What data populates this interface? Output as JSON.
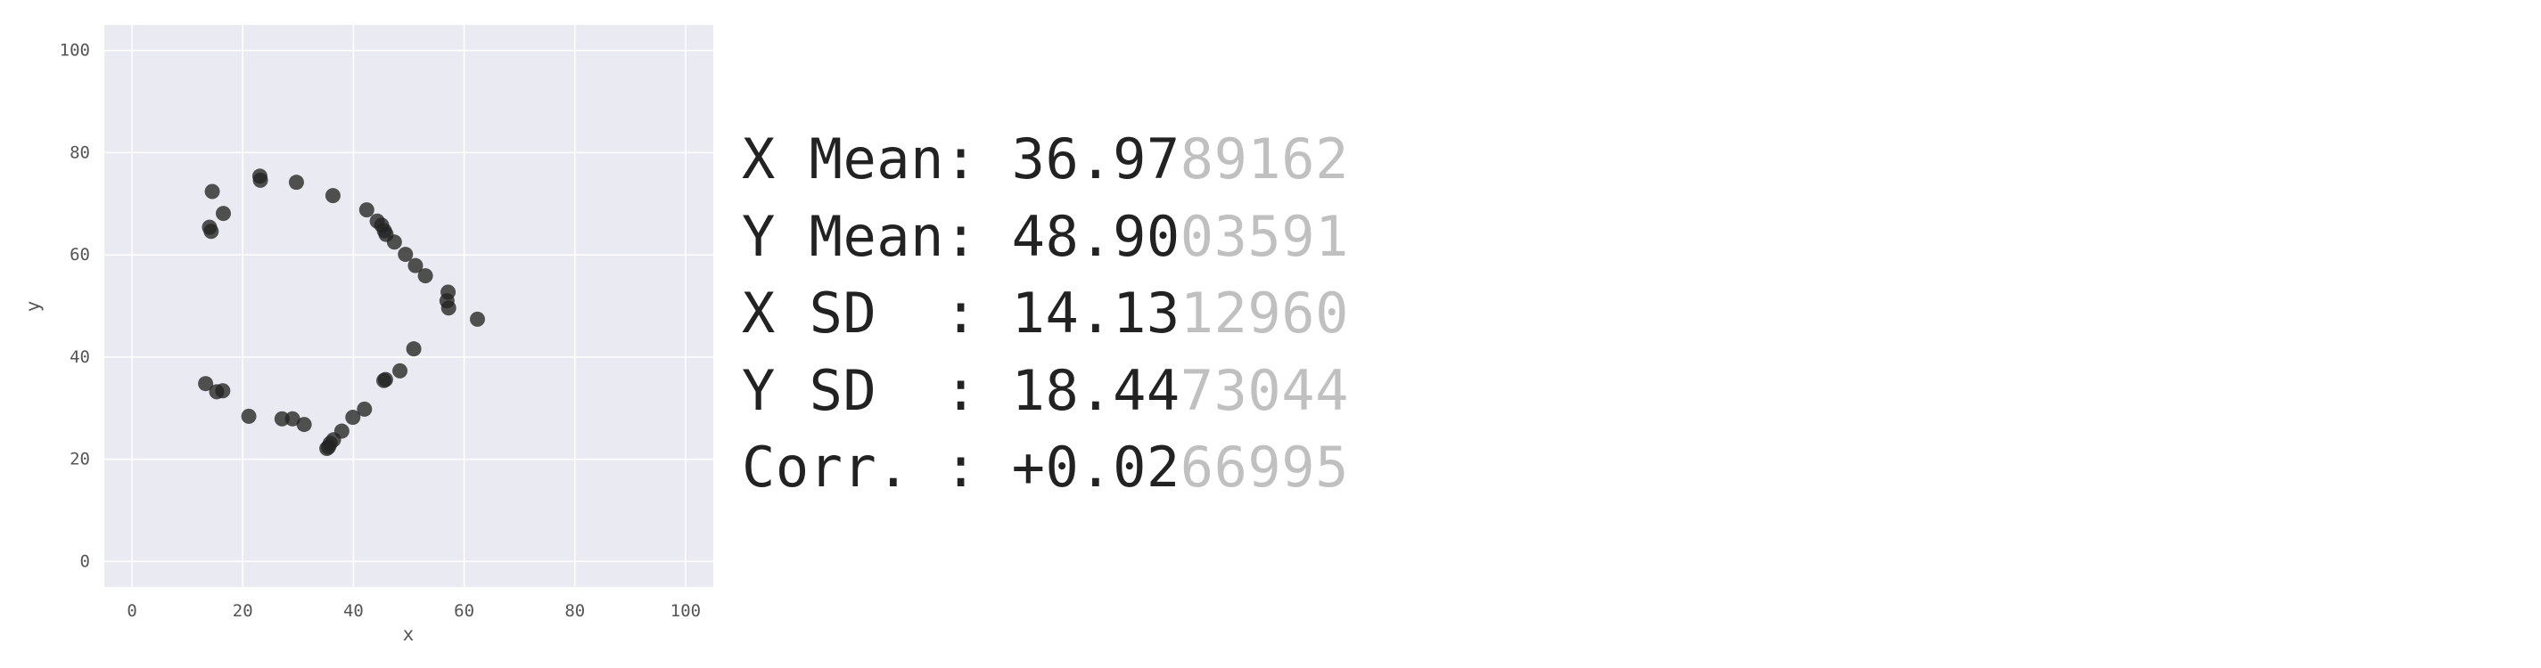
{
  "chart_data": {
    "type": "scatter",
    "title": "",
    "xlabel": "x",
    "ylabel": "y",
    "xlim": [
      -5,
      105
    ],
    "ylim": [
      -5,
      105
    ],
    "xticks": [
      0,
      20,
      40,
      60,
      80,
      100
    ],
    "yticks": [
      0,
      20,
      40,
      60,
      80,
      100
    ],
    "grid": true,
    "background_color": "#eaeaf2",
    "point_color": "#222222",
    "points": [
      [
        23.1,
        75.4
      ],
      [
        23.2,
        74.6
      ],
      [
        29.7,
        74.2
      ],
      [
        36.3,
        71.6
      ],
      [
        14.5,
        72.4
      ],
      [
        16.5,
        68.1
      ],
      [
        14.0,
        65.4
      ],
      [
        14.3,
        64.6
      ],
      [
        42.4,
        68.8
      ],
      [
        44.3,
        66.6
      ],
      [
        45.1,
        65.8
      ],
      [
        45.6,
        64.7
      ],
      [
        45.9,
        64.0
      ],
      [
        47.4,
        62.5
      ],
      [
        49.4,
        60.1
      ],
      [
        51.2,
        57.9
      ],
      [
        53.0,
        55.9
      ],
      [
        57.1,
        52.7
      ],
      [
        56.9,
        51.0
      ],
      [
        57.2,
        49.6
      ],
      [
        62.4,
        47.4
      ],
      [
        50.9,
        41.6
      ],
      [
        48.4,
        37.3
      ],
      [
        45.8,
        35.6
      ],
      [
        45.5,
        35.4
      ],
      [
        13.3,
        34.8
      ],
      [
        15.3,
        33.2
      ],
      [
        16.4,
        33.4
      ],
      [
        21.1,
        28.4
      ],
      [
        27.1,
        27.9
      ],
      [
        29.0,
        27.9
      ],
      [
        31.1,
        26.8
      ],
      [
        42.0,
        29.8
      ],
      [
        39.9,
        28.2
      ],
      [
        37.9,
        25.5
      ],
      [
        36.4,
        23.8
      ],
      [
        35.8,
        23.1
      ],
      [
        35.5,
        22.4
      ],
      [
        35.2,
        22.1
      ]
    ]
  },
  "stats": [
    {
      "label": "X Mean: ",
      "bold_value": "36.97",
      "faded_value": "89162"
    },
    {
      "label": "Y Mean: ",
      "bold_value": "48.90",
      "faded_value": "03591"
    },
    {
      "label": "X SD  : ",
      "bold_value": "14.13",
      "faded_value": "12960"
    },
    {
      "label": "Y SD  : ",
      "bold_value": "18.44",
      "faded_value": "73044"
    },
    {
      "label": "Corr. : ",
      "bold_value": "+0.02",
      "faded_value": "66995"
    }
  ]
}
